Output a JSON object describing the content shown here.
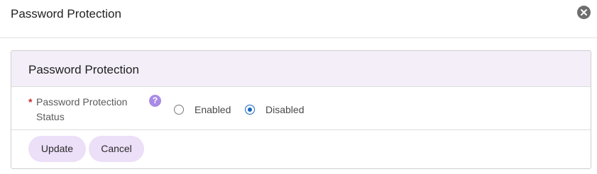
{
  "dialog": {
    "title": "Password Protection",
    "close_icon": "close-circle-icon"
  },
  "card": {
    "title": "Password Protection",
    "field": {
      "required_mark": "*",
      "label": "Password Protection Status",
      "help_icon": "question-circle-icon",
      "help_glyph": "?",
      "options": [
        {
          "label": "Enabled",
          "selected": false
        },
        {
          "label": "Disabled",
          "selected": true
        }
      ]
    },
    "buttons": {
      "update_label": "Update",
      "cancel_label": "Cancel"
    }
  },
  "colors": {
    "header_bg": "#f3eef8",
    "button_bg": "#ecdff8",
    "help_icon": "#a98be6",
    "radio_selected": "#1565c0",
    "required": "#c62828"
  }
}
